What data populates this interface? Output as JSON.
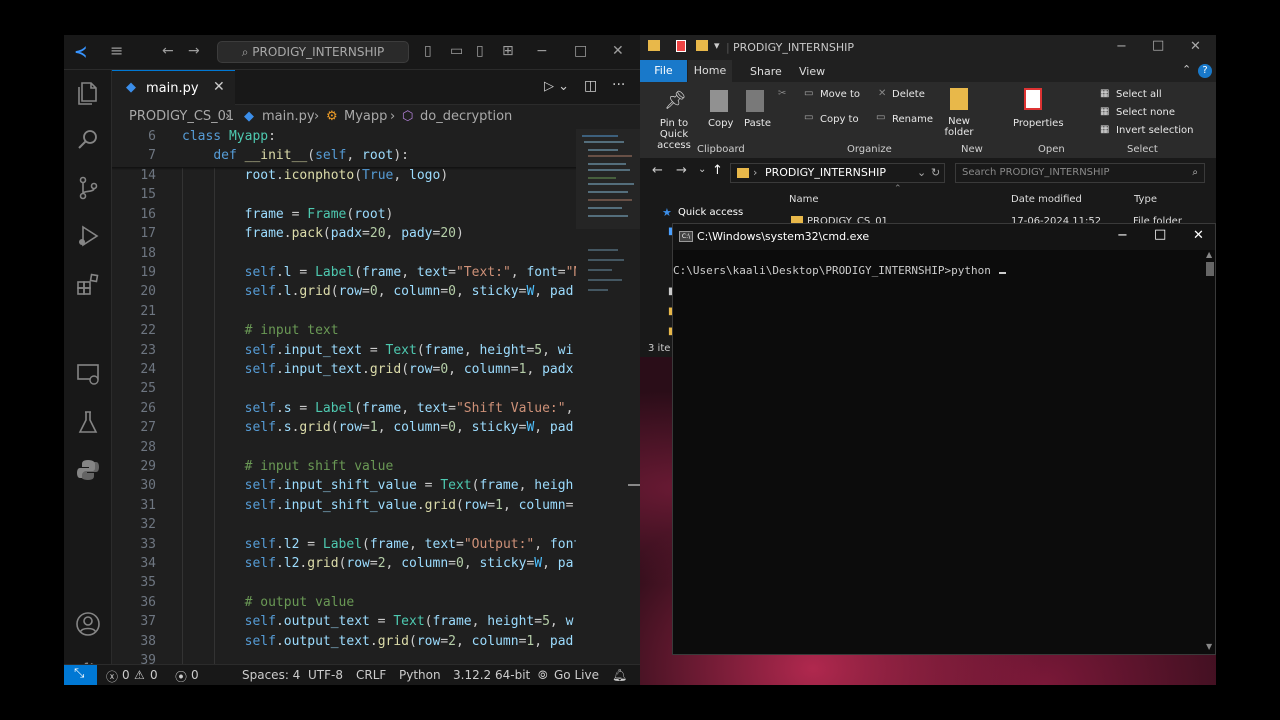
{
  "vscode": {
    "search_text": "PRODIGY_INTERNSHIP",
    "tab_label": "main.py",
    "breadcrumb": [
      "PRODIGY_CS_01",
      "main.py",
      "Myapp",
      "do_decryption"
    ],
    "sticky_lines": [
      {
        "num": "6",
        "text": "class Myapp:"
      },
      {
        "num": "7",
        "text": "    def __init__(self, root):"
      }
    ],
    "lines": [
      {
        "num": "14",
        "text": "        root.iconphoto(True, logo)"
      },
      {
        "num": "15",
        "text": ""
      },
      {
        "num": "16",
        "text": "        frame = Frame(root)"
      },
      {
        "num": "17",
        "text": "        frame.pack(padx=20, pady=20)"
      },
      {
        "num": "18",
        "text": ""
      },
      {
        "num": "19",
        "text": "        self.l = Label(frame, text=\"Text:\", font=\"N"
      },
      {
        "num": "20",
        "text": "        self.l.grid(row=0, column=0, sticky=W, pad"
      },
      {
        "num": "21",
        "text": ""
      },
      {
        "num": "22",
        "text": "        # input text"
      },
      {
        "num": "23",
        "text": "        self.input_text = Text(frame, height=5, wi"
      },
      {
        "num": "24",
        "text": "        self.input_text.grid(row=0, column=1, padx"
      },
      {
        "num": "25",
        "text": ""
      },
      {
        "num": "26",
        "text": "        self.s = Label(frame, text=\"Shift Value:\","
      },
      {
        "num": "27",
        "text": "        self.s.grid(row=1, column=0, sticky=W, pad"
      },
      {
        "num": "28",
        "text": ""
      },
      {
        "num": "29",
        "text": "        # input shift value"
      },
      {
        "num": "30",
        "text": "        self.input_shift_value = Text(frame, heigh"
      },
      {
        "num": "31",
        "text": "        self.input_shift_value.grid(row=1, column="
      },
      {
        "num": "32",
        "text": ""
      },
      {
        "num": "33",
        "text": "        self.l2 = Label(frame, text=\"Output:\", font"
      },
      {
        "num": "34",
        "text": "        self.l2.grid(row=2, column=0, sticky=W, pa"
      },
      {
        "num": "35",
        "text": ""
      },
      {
        "num": "36",
        "text": "        # output value"
      },
      {
        "num": "37",
        "text": "        self.output_text = Text(frame, height=5, w"
      },
      {
        "num": "38",
        "text": "        self.output_text.grid(row=2, column=1, pad"
      },
      {
        "num": "39",
        "text": ""
      }
    ],
    "status": {
      "errors": "0",
      "warnings": "0",
      "ports": "0",
      "spaces": "Spaces: 4",
      "encoding": "UTF-8",
      "eol": "CRLF",
      "language": "Python",
      "interpreter": "3.12.2 64-bit",
      "golive": "Go Live"
    }
  },
  "explorer": {
    "title": "PRODIGY_INTERNSHIP",
    "menu": [
      "File",
      "Home",
      "Share",
      "View"
    ],
    "ribbon": {
      "pin": "Pin to Quick access",
      "copy": "Copy",
      "paste": "Paste",
      "move_to": "Move to",
      "copy_to": "Copy to",
      "delete": "Delete",
      "rename": "Rename",
      "new_folder": "New folder",
      "properties": "Properties",
      "select_all": "Select all",
      "select_none": "Select none",
      "invert_selection": "Invert selection",
      "groups": [
        "Clipboard",
        "Organize",
        "New",
        "Open",
        "Select"
      ]
    },
    "address": "PRODIGY_INTERNSHIP",
    "search_placeholder": "Search PRODIGY_INTERNSHIP",
    "quick_access": "Quick access",
    "columns": [
      "Name",
      "Date modified",
      "Type"
    ],
    "first_item": {
      "name": "PRODIGY_CS_01",
      "date": "17-06-2024 11:52",
      "type": "File folder"
    },
    "status": "3 ite"
  },
  "cmd": {
    "title": "C:\\Windows\\system32\\cmd.exe",
    "prompt": "C:\\Users\\kaali\\Desktop\\PRODIGY_INTERNSHIP>python "
  },
  "colors": {
    "vscode_accent": "#0078d4",
    "explorer_file_tab": "#1979ca",
    "keyword": "#569cd6",
    "string": "#ce9178",
    "comment": "#6a9955",
    "class_name": "#4ec9b0",
    "function": "#dcdcaa",
    "variable": "#9cdcfe",
    "number": "#b5cea8"
  }
}
